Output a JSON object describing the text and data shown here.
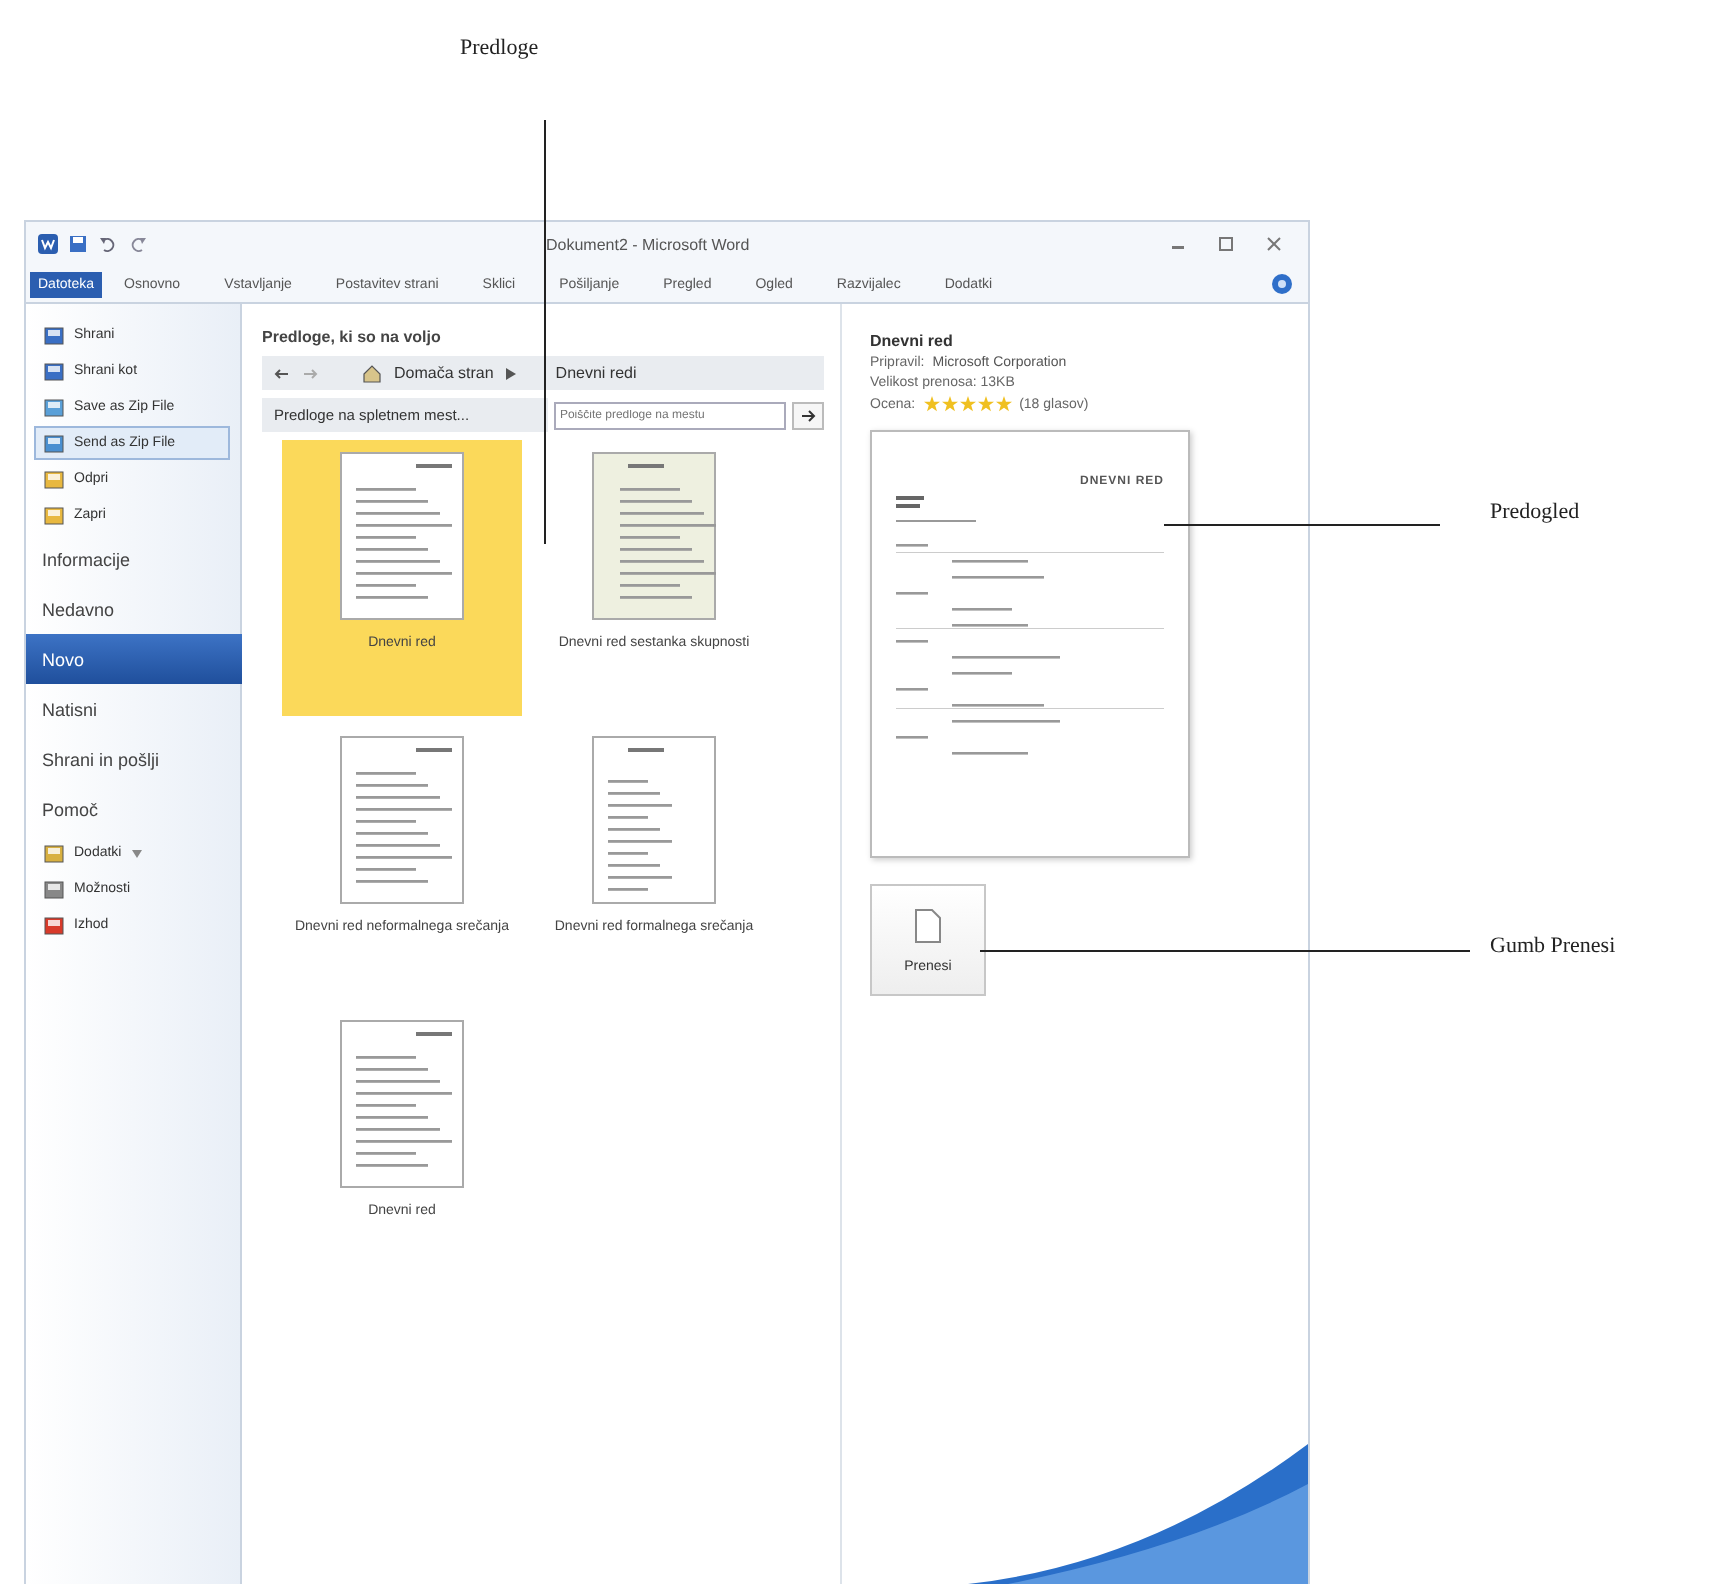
{
  "annotations": [
    {
      "label": "Predloge"
    },
    {
      "label": "Predogled"
    },
    {
      "label": "Gumb Prenesi"
    }
  ],
  "window": {
    "title": "Dokument2 - Microsoft Word"
  },
  "ribbon_tabs": [
    {
      "label": "Datoteka",
      "selected": true
    },
    {
      "label": "Osnovno",
      "selected": false
    },
    {
      "label": "Vstavljanje",
      "selected": false
    },
    {
      "label": "Postavitev strani",
      "selected": false
    },
    {
      "label": "Sklici",
      "selected": false
    },
    {
      "label": "Pošiljanje",
      "selected": false
    },
    {
      "label": "Pregled",
      "selected": false
    },
    {
      "label": "Ogled",
      "selected": false
    },
    {
      "label": "Razvijalec",
      "selected": false
    },
    {
      "label": "Dodatki",
      "selected": false
    }
  ],
  "sidebar": {
    "items": [
      {
        "kind": "command",
        "label": "Shrani",
        "selected": false,
        "highlighted": false
      },
      {
        "kind": "command",
        "label": "Shrani kot",
        "selected": false,
        "highlighted": false
      },
      {
        "kind": "command",
        "label": "Save as Zip File",
        "selected": false,
        "highlighted": false
      },
      {
        "kind": "command",
        "label": "Send as Zip File",
        "selected": false,
        "highlighted": true
      },
      {
        "kind": "command",
        "label": "Odpri",
        "selected": false,
        "highlighted": false
      },
      {
        "kind": "command",
        "label": "Zapri",
        "selected": false,
        "highlighted": false
      },
      {
        "kind": "section",
        "label": "Informacije",
        "selected": false,
        "highlighted": false
      },
      {
        "kind": "section",
        "label": "Nedavno",
        "selected": false,
        "highlighted": false
      },
      {
        "kind": "section",
        "label": "Novo",
        "selected": true,
        "highlighted": false
      },
      {
        "kind": "section",
        "label": "Natisni",
        "selected": false,
        "highlighted": false
      },
      {
        "kind": "section",
        "label": "Shrani in pošlji",
        "selected": false,
        "highlighted": false
      },
      {
        "kind": "section",
        "label": "Pomoč",
        "selected": false,
        "highlighted": false
      },
      {
        "kind": "command",
        "label": "Dodatki",
        "dropdown": true,
        "selected": false,
        "highlighted": false
      },
      {
        "kind": "command",
        "label": "Možnosti",
        "selected": false,
        "highlighted": false
      },
      {
        "kind": "command",
        "label": "Izhod",
        "selected": false,
        "highlighted": false
      }
    ]
  },
  "templates": {
    "heading": "Predloge, ki so na voljo",
    "breadcrumb": {
      "home": "Domača stran",
      "current": "Dnevni redi"
    },
    "online_button": "Predloge na spletnem mest...",
    "search": {
      "placeholder": "Poiščite predloge na mestu"
    },
    "items": [
      {
        "label": "Dnevni red",
        "selected": true
      },
      {
        "label": "Dnevni red sestanka skupnosti",
        "selected": false
      },
      {
        "label": "Dnevni red neformalnega srečanja",
        "selected": false
      },
      {
        "label": "Dnevni red formalnega srečanja",
        "selected": false
      },
      {
        "label": "Dnevni red",
        "selected": false
      }
    ]
  },
  "details": {
    "title": "Dnevni red",
    "author_label": "Pripravil:",
    "author": "Microsoft Corporation",
    "size": "Velikost prenosa: 13KB",
    "rating_label": "Ocena:",
    "stars": 5,
    "votes": "(18 glasov)",
    "preview_heading": "DNEVNI RED",
    "download_button": "Prenesi"
  }
}
